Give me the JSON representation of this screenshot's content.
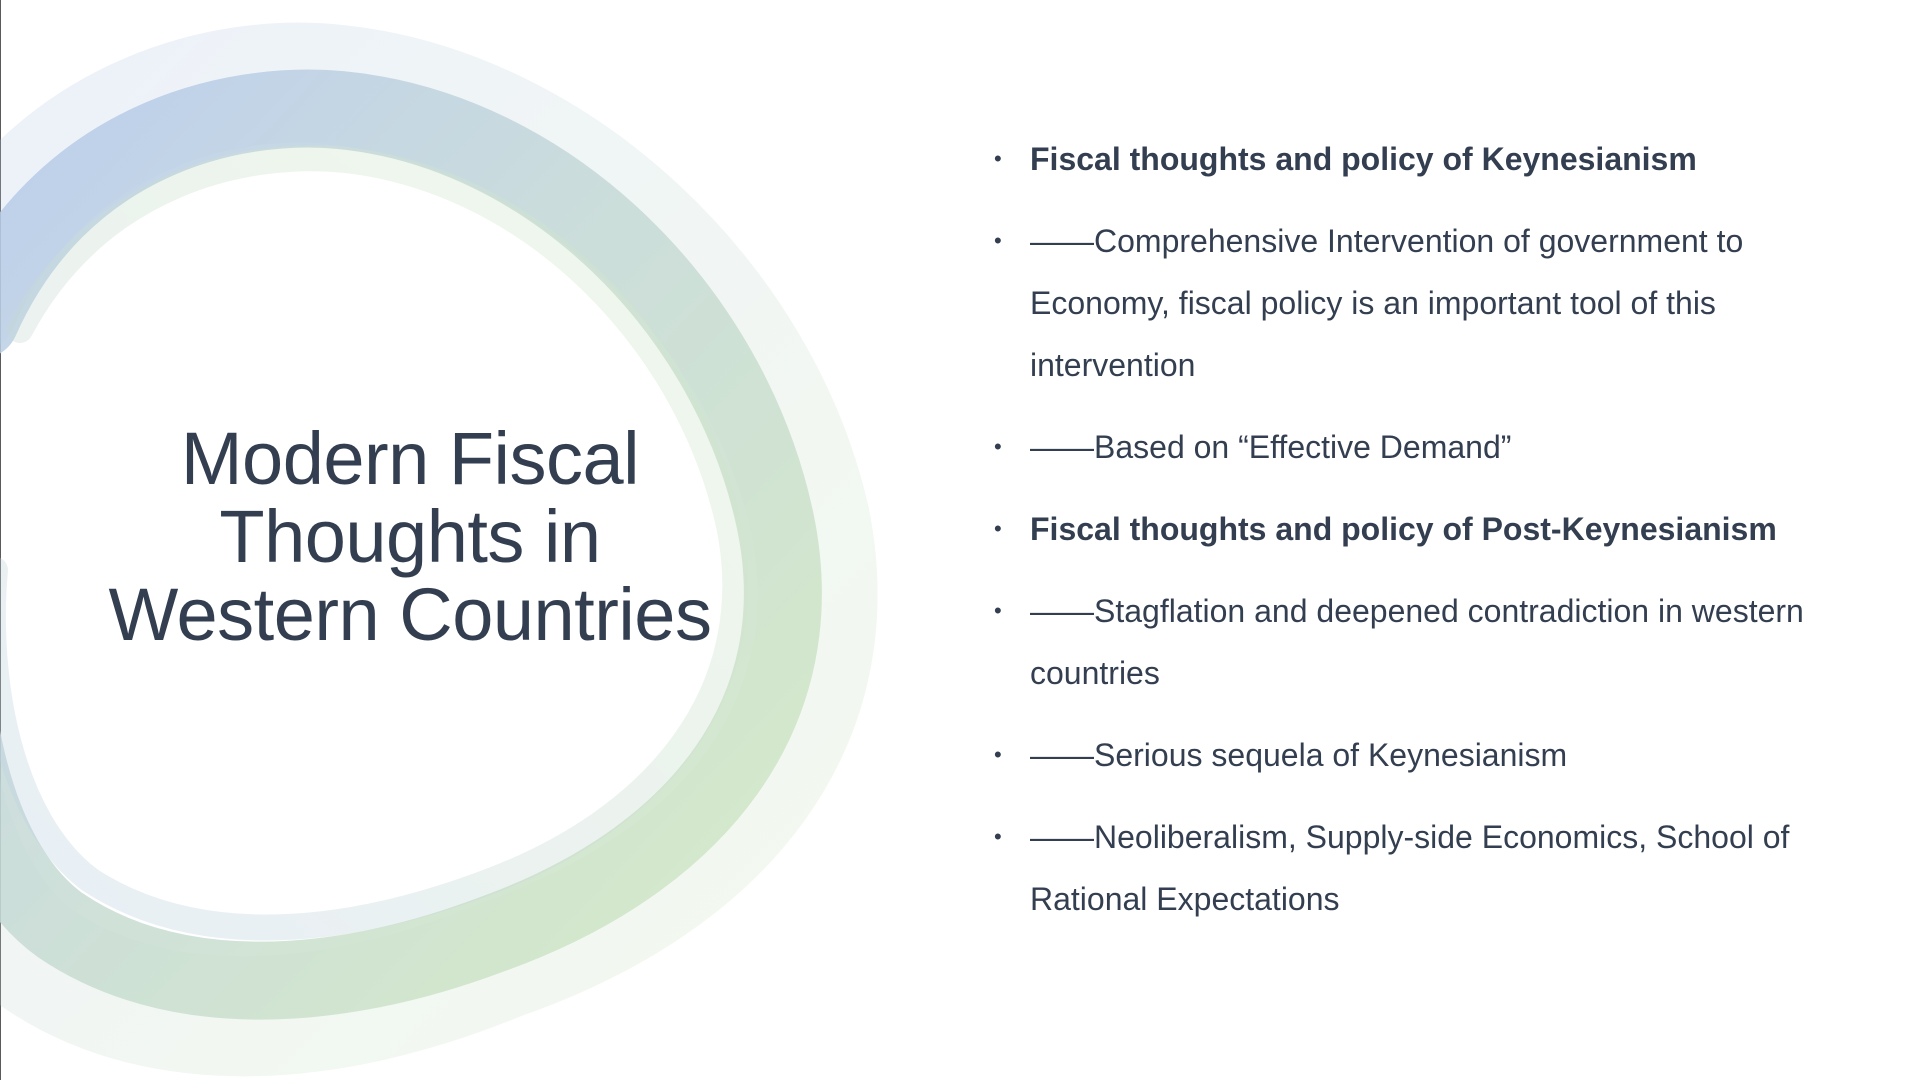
{
  "slide": {
    "title_lines": [
      "Modern Fiscal",
      "Thoughts in",
      "Western Countries"
    ],
    "bullets": [
      {
        "text": "Fiscal thoughts and policy of Keynesianism",
        "bold": true
      },
      {
        "text": "——Comprehensive Intervention of  government to Economy, fiscal policy is an important tool of this intervention",
        "bold": false
      },
      {
        "text": "——Based on “Effective Demand”",
        "bold": false
      },
      {
        "text": "Fiscal thoughts and policy of Post-Keynesianism",
        "bold": true
      },
      {
        "text": "——Stagflation and deepened contradiction in western countries",
        "bold": false
      },
      {
        "text": "——Serious sequela of Keynesianism",
        "bold": false
      },
      {
        "text": "——Neoliberalism, Supply-side Economics, School of Rational Expectations",
        "bold": false
      }
    ],
    "bullet_glyph": "•"
  },
  "colors": {
    "text": "#333f50",
    "ring_blue": "#b4c8ec",
    "ring_teal": "#c5d9d6",
    "ring_green": "#d0e8c0"
  }
}
